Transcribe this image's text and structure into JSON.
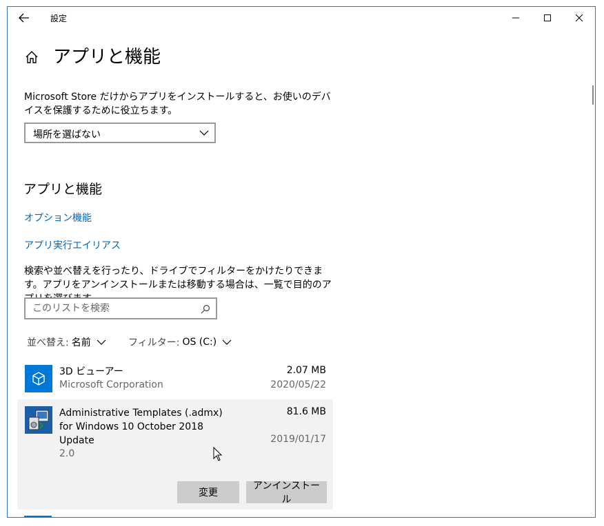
{
  "window": {
    "title": "設定"
  },
  "header": {
    "page_title": "アプリと機能"
  },
  "store_section": {
    "description": "Microsoft Store だけからアプリをインストールすると、お使いのデバイスを保護するために役立ちます。",
    "dropdown_value": "場所を選ばない"
  },
  "apps_section": {
    "title": "アプリと機能",
    "link_optional": "オプション機能",
    "link_alias": "アプリ実行エイリアス",
    "search_description": "検索や並べ替えを行ったり、ドライブでフィルターをかけたりできます。アプリをアンインストールまたは移動する場合は、一覧で目的のアプリを選びます。",
    "search_placeholder": "このリストを検索",
    "sort_label": "並べ替え:",
    "sort_value": "名前",
    "filter_label": "フィルター:",
    "filter_value": "OS (C:)"
  },
  "apps": [
    {
      "name": "3D ビューアー",
      "publisher": "Microsoft Corporation",
      "size": "2.07 MB",
      "date": "2020/05/22",
      "icon": "3d-viewer-icon"
    },
    {
      "name": "Administrative Templates (.admx) for Windows 10 October 2018 Update",
      "version": "2.0",
      "size": "81.6 MB",
      "date": "2019/01/17",
      "icon": "installer-icon",
      "modify_label": "変更",
      "uninstall_label": "アンインストール"
    }
  ],
  "colors": {
    "accent": "#0078d7",
    "link": "#0067b8",
    "window_border": "#2b79c2",
    "selected_bg": "#f2f2f2",
    "button_bg": "#cccccc"
  }
}
